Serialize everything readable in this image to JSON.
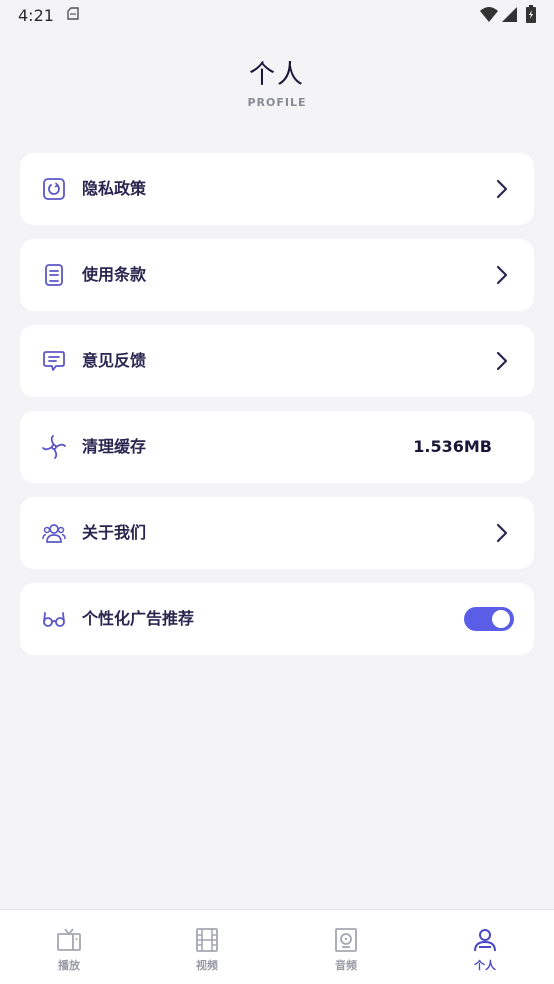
{
  "status_bar": {
    "time": "4:21"
  },
  "header": {
    "title": "个人",
    "subtitle": "PROFILE"
  },
  "menu": {
    "privacy": {
      "label": "隐私政策",
      "icon": "privacy-icon"
    },
    "terms": {
      "label": "使用条款",
      "icon": "document-icon"
    },
    "feedback": {
      "label": "意见反馈",
      "icon": "message-icon"
    },
    "cache": {
      "label": "清理缓存",
      "icon": "fan-icon",
      "value": "1.536MB"
    },
    "about": {
      "label": "关于我们",
      "icon": "users-icon"
    },
    "ads": {
      "label": "个性化广告推荐",
      "icon": "glasses-icon",
      "enabled": true
    }
  },
  "tabs": [
    {
      "label": "播放",
      "icon": "tv-icon",
      "active": false
    },
    {
      "label": "视频",
      "icon": "film-icon",
      "active": false
    },
    {
      "label": "音频",
      "icon": "speaker-icon",
      "active": false
    },
    {
      "label": "个人",
      "icon": "person-icon",
      "active": true
    }
  ],
  "colors": {
    "accent": "#5a5ee6",
    "icon": "#5b57c8",
    "background": "#f4f4f6"
  }
}
